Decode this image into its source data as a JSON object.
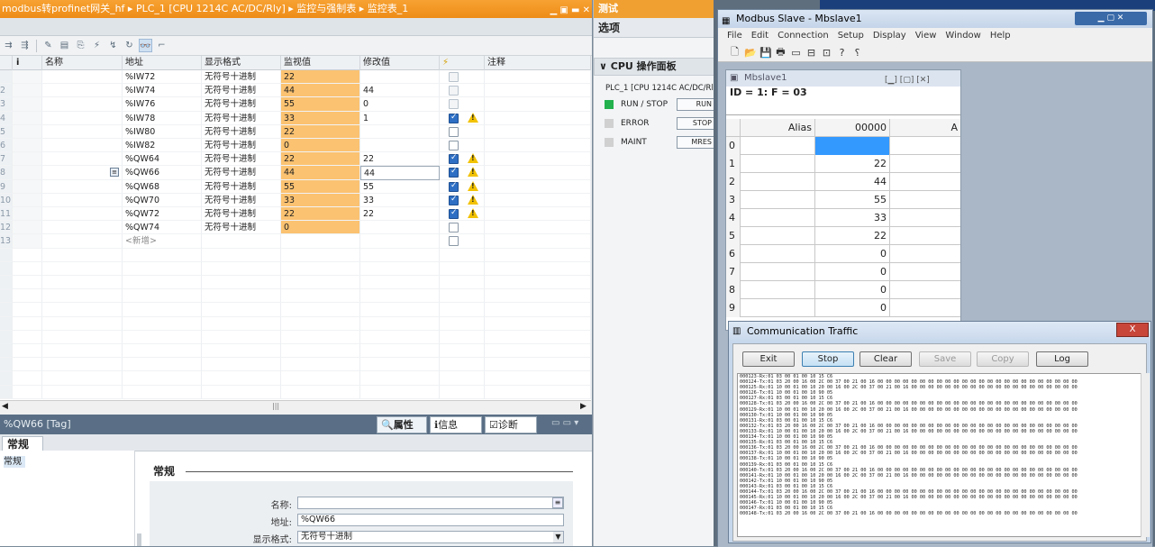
{
  "tia": {
    "title": "modbus转profinet网关_hf ▸ PLC_1 [CPU 1214C AC/DC/Rly] ▸ 监控与强制表 ▸ 监控表_1",
    "columns": {
      "info": "i",
      "name": "名称",
      "address": "地址",
      "format": "显示格式",
      "monitor": "监视值",
      "modify": "修改值",
      "lightning": "⚡",
      "comment": "注释"
    },
    "rows": [
      {
        "n": "",
        "address": "%IW72",
        "format": "无符号十进制",
        "monitor": "22",
        "modify": "",
        "check": "dis",
        "warn": false
      },
      {
        "n": "2",
        "address": "%IW74",
        "format": "无符号十进制",
        "monitor": "44",
        "modify": "44",
        "check": "dis",
        "warn": false
      },
      {
        "n": "3",
        "address": "%IW76",
        "format": "无符号十进制",
        "monitor": "55",
        "modify": "0",
        "check": "dis",
        "warn": false
      },
      {
        "n": "4",
        "address": "%IW78",
        "format": "无符号十进制",
        "monitor": "33",
        "modify": "1",
        "check": "on",
        "warn": true
      },
      {
        "n": "5",
        "address": "%IW80",
        "format": "无符号十进制",
        "monitor": "22",
        "modify": "",
        "check": "off",
        "warn": false
      },
      {
        "n": "6",
        "address": "%IW82",
        "format": "无符号十进制",
        "monitor": "0",
        "modify": "",
        "check": "off",
        "warn": false
      },
      {
        "n": "7",
        "address": "%QW64",
        "format": "无符号十进制",
        "monitor": "22",
        "modify": "22",
        "check": "on",
        "warn": true
      },
      {
        "n": "8",
        "address": "%QW66",
        "format": "无符号十进制",
        "monitor": "44",
        "modify": "44",
        "check": "on",
        "warn": true
      },
      {
        "n": "9",
        "address": "%QW68",
        "format": "无符号十进制",
        "monitor": "55",
        "modify": "55",
        "check": "on",
        "warn": true
      },
      {
        "n": "10",
        "address": "%QW70",
        "format": "无符号十进制",
        "monitor": "33",
        "modify": "33",
        "check": "on",
        "warn": true
      },
      {
        "n": "11",
        "address": "%QW72",
        "format": "无符号十进制",
        "monitor": "22",
        "modify": "22",
        "check": "on",
        "warn": true
      },
      {
        "n": "12",
        "address": "%QW74",
        "format": "无符号十进制",
        "monitor": "0",
        "modify": "",
        "check": "off",
        "warn": false
      },
      {
        "n": "13",
        "address": "<新增>",
        "format": "",
        "monitor": "",
        "modify": "",
        "check": "off",
        "warn": false
      }
    ],
    "props": {
      "title": "%QW66 [Tag]",
      "tabs": [
        "属性",
        "信息",
        "诊断"
      ],
      "section_tab": "常规",
      "left_item": "常规",
      "section_heading": "常规",
      "name_label": "名称:",
      "name_value": "",
      "address_label": "地址:",
      "address_value": "%QW66",
      "format_label": "显示格式:",
      "format_value": "无符号十进制"
    }
  },
  "mid": {
    "title": "测试",
    "options": "选项",
    "cpu_panel": "CPU 操作面板",
    "plc": "PLC_1 [CPU 1214C AC/DC/Rly]",
    "leds": [
      {
        "label": "RUN / STOP",
        "color": "#22b14c",
        "button": "RUN"
      },
      {
        "label": "ERROR",
        "color": "#d0d0d0",
        "button": "STOP"
      },
      {
        "label": "MAINT",
        "color": "#d0d0d0",
        "button": "MRES"
      }
    ]
  },
  "modbus": {
    "title": "Modbus Slave - Mbslave1",
    "menu": [
      "File",
      "Edit",
      "Connection",
      "Setup",
      "Display",
      "View",
      "Window",
      "Help"
    ],
    "child_title": "Mbslave1",
    "id_line": "ID = 1: F = 03",
    "col_alias": "Alias",
    "col_addr": "00000",
    "col_next": "A",
    "rows": [
      {
        "i": "0",
        "v": ""
      },
      {
        "i": "1",
        "v": "22"
      },
      {
        "i": "2",
        "v": "44"
      },
      {
        "i": "3",
        "v": "55"
      },
      {
        "i": "4",
        "v": "33"
      },
      {
        "i": "5",
        "v": "22"
      },
      {
        "i": "6",
        "v": "0"
      },
      {
        "i": "7",
        "v": "0"
      },
      {
        "i": "8",
        "v": "0"
      },
      {
        "i": "9",
        "v": "0"
      }
    ]
  },
  "traffic": {
    "title": "Communication Traffic",
    "close": "X",
    "buttons": [
      "Exit",
      "Stop",
      "Clear",
      "Save",
      "Copy",
      "Log"
    ],
    "lines": [
      "000123-Rx:01 03 00 01 00 10 15 C6",
      "000124-Tx:01 03 20 00 16 00 2C 00 37 00 21 00 16 00 00 00 00 00 00 00 00 00 00 00 00 00 00 00 00 00 00 00 00 00 00 00 00",
      "000125-Rx:01 10 00 01 00 10 20 00 16 00 2C 00 37 00 21 00 16 00 00 00 00 00 00 00 00 00 00 00 00 00 00 00 00 00 00 00 00",
      "000126-Tx:01 10 00 01 00 10 90 05",
      "000127-Rx:01 03 00 01 00 10 15 C6",
      "000128-Tx:01 03 20 00 16 00 2C 00 37 00 21 00 16 00 00 00 00 00 00 00 00 00 00 00 00 00 00 00 00 00 00 00 00 00 00 00 00",
      "000129-Rx:01 10 00 01 00 10 20 00 16 00 2C 00 37 00 21 00 16 00 00 00 00 00 00 00 00 00 00 00 00 00 00 00 00 00 00 00 00",
      "000130-Tx:01 10 00 01 00 10 90 05",
      "000131-Rx:01 03 00 01 00 10 15 C6",
      "000132-Tx:01 03 20 00 16 00 2C 00 37 00 21 00 16 00 00 00 00 00 00 00 00 00 00 00 00 00 00 00 00 00 00 00 00 00 00 00 00",
      "000133-Rx:01 10 00 01 00 10 20 00 16 00 2C 00 37 00 21 00 16 00 00 00 00 00 00 00 00 00 00 00 00 00 00 00 00 00 00 00 00",
      "000134-Tx:01 10 00 01 00 10 90 05",
      "000135-Rx:01 03 00 01 00 10 15 C6",
      "000136-Tx:01 03 20 00 16 00 2C 00 37 00 21 00 16 00 00 00 00 00 00 00 00 00 00 00 00 00 00 00 00 00 00 00 00 00 00 00 00",
      "000137-Rx:01 10 00 01 00 10 20 00 16 00 2C 00 37 00 21 00 16 00 00 00 00 00 00 00 00 00 00 00 00 00 00 00 00 00 00 00 00",
      "000138-Tx:01 10 00 01 00 10 90 05",
      "000139-Rx:01 03 00 01 00 10 15 C6",
      "000140-Tx:01 03 20 00 16 00 2C 00 37 00 21 00 16 00 00 00 00 00 00 00 00 00 00 00 00 00 00 00 00 00 00 00 00 00 00 00 00",
      "000141-Rx:01 10 00 01 00 10 20 00 16 00 2C 00 37 00 21 00 16 00 00 00 00 00 00 00 00 00 00 00 00 00 00 00 00 00 00 00 00",
      "000142-Tx:01 10 00 01 00 10 90 05",
      "000143-Rx:01 03 00 01 00 10 15 C6",
      "000144-Tx:01 03 20 00 16 00 2C 00 37 00 21 00 16 00 00 00 00 00 00 00 00 00 00 00 00 00 00 00 00 00 00 00 00 00 00 00 00",
      "000145-Rx:01 10 00 01 00 10 20 00 16 00 2C 00 37 00 21 00 16 00 00 00 00 00 00 00 00 00 00 00 00 00 00 00 00 00 00 00 00",
      "000146-Tx:01 10 00 01 00 10 90 05",
      "000147-Rx:01 03 00 01 00 10 15 C6",
      "000148-Tx:01 03 20 00 16 00 2C 00 37 00 21 00 16 00 00 00 00 00 00 00 00 00 00 00 00 00 00 00 00 00 00 00 00 00 00 00 00"
    ]
  }
}
